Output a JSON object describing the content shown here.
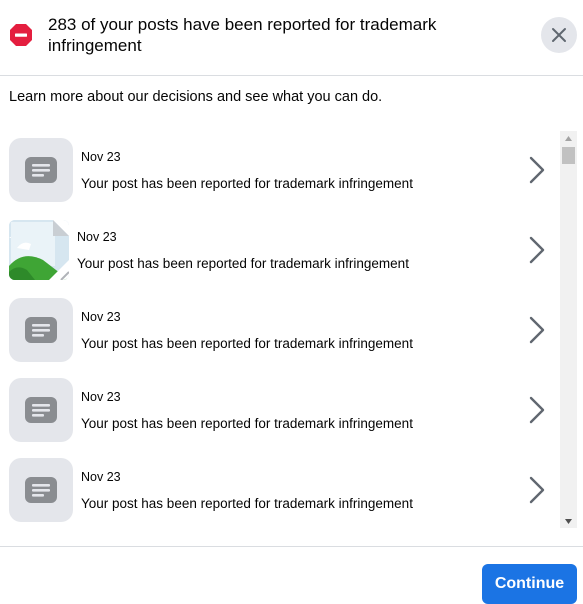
{
  "dialog": {
    "title": "283 of your posts have been reported for trademark infringement",
    "subtitle": "Learn more about our decisions and see what you can do.",
    "close_label": "Close"
  },
  "items": [
    {
      "date": "Nov 23",
      "text": "Your post has been reported for trademark infringement",
      "thumb": "post-icon"
    },
    {
      "date": "Nov 23",
      "text": "Your post has been reported for trademark infringement",
      "thumb": "image-thumbnail"
    },
    {
      "date": "Nov 23",
      "text": "Your post has been reported for trademark infringement",
      "thumb": "post-icon"
    },
    {
      "date": "Nov 23",
      "text": "Your post has been reported for trademark infringement",
      "thumb": "post-icon"
    },
    {
      "date": "Nov 23",
      "text": "Your post has been reported for trademark infringement",
      "thumb": "post-icon"
    }
  ],
  "footer": {
    "continue_label": "Continue"
  },
  "colors": {
    "accent": "#1b74e4",
    "stop": "#e41e3f",
    "thumb_bg": "#e4e6eb",
    "icon_gray": "#65676b"
  }
}
